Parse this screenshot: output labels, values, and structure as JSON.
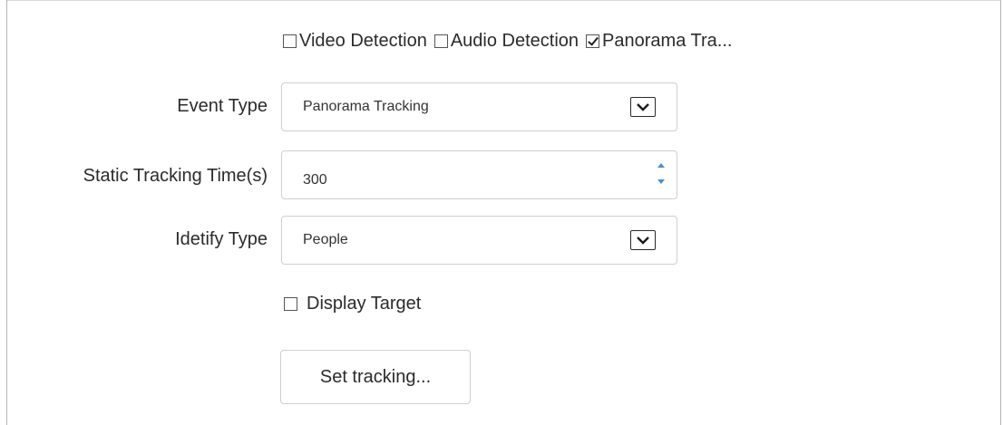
{
  "detection_types": [
    {
      "label": "Video Detection",
      "checked": false
    },
    {
      "label": "Audio Detection",
      "checked": false
    },
    {
      "label": "Panorama Tra...",
      "checked": true
    }
  ],
  "event_type": {
    "label": "Event Type",
    "value": "Panorama Tracking"
  },
  "static_tracking_time": {
    "label": "Static Tracking Time(s)",
    "value": "300"
  },
  "identify_type": {
    "label": "Idetify Type",
    "value": "People"
  },
  "display_target": {
    "label": "Display Target",
    "checked": false
  },
  "set_tracking_button": {
    "label": "Set tracking..."
  },
  "colors": {
    "border": "#cfcfcf",
    "spinner_arrow": "#4a90c8",
    "text": "#2b2b2b"
  },
  "icons": {
    "dropdown": "chevron-down-icon",
    "spinner_up": "arrow-up-icon",
    "spinner_down": "arrow-down-icon",
    "checkmark": "checkmark-icon"
  }
}
